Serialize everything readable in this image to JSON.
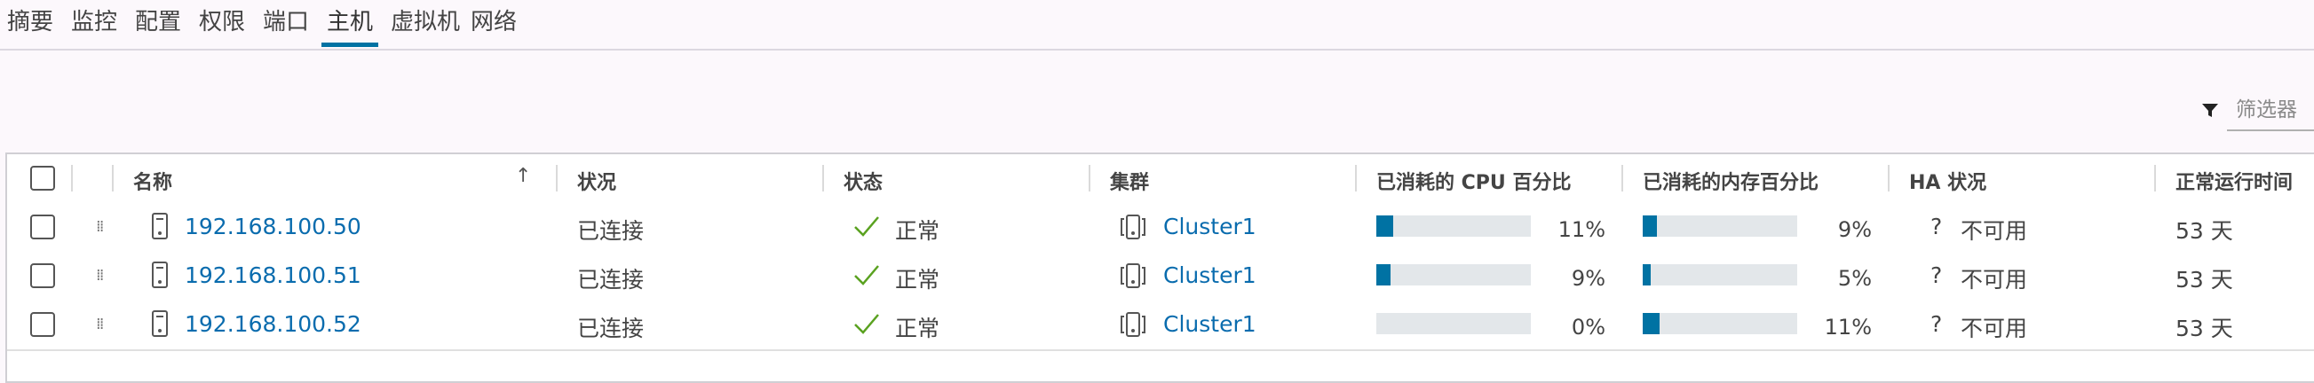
{
  "tabs": [
    "摘要",
    "监控",
    "配置",
    "权限",
    "端口",
    "主机",
    "虚拟机",
    "网络"
  ],
  "active_tab": "主机",
  "filter": {
    "placeholder": "筛选器"
  },
  "columns": {
    "name": "名称",
    "condition": "状况",
    "state": "状态",
    "cluster": "集群",
    "cpu": "已消耗的 CPU 百分比",
    "memory": "已消耗的内存百分比",
    "ha": "HA 状况",
    "uptime": "正常运行时间"
  },
  "rows": [
    {
      "name": "192.168.100.50",
      "condition": "已连接",
      "state": "正常",
      "cluster": "Cluster1",
      "cpu": "11%",
      "cpu_value": 0.11,
      "memory": "9%",
      "memory_value": 0.09,
      "ha_icon": "?",
      "ha": "不可用",
      "uptime": "53 天"
    },
    {
      "name": "192.168.100.51",
      "condition": "已连接",
      "state": "正常",
      "cluster": "Cluster1",
      "cpu": "9%",
      "cpu_value": 0.09,
      "memory": "5%",
      "memory_value": 0.05,
      "ha_icon": "?",
      "ha": "不可用",
      "uptime": "53 天"
    },
    {
      "name": "192.168.100.52",
      "condition": "已连接",
      "state": "正常",
      "cluster": "Cluster1",
      "cpu": "0%",
      "cpu_value": 0.0,
      "memory": "11%",
      "memory_value": 0.11,
      "ha_icon": "?",
      "ha": "不可用",
      "uptime": "53 天"
    }
  ],
  "colors": {
    "accent": "#0072a3",
    "link": "#0a6cae",
    "ok": "#5aa220",
    "bar_track": "#e3e7ea"
  },
  "icons": {
    "sort": "arrow-up-icon",
    "filter": "funnel-icon",
    "host": "server-icon",
    "state": "checkmark-icon",
    "cluster": "cluster-icon",
    "drag": "drag-handle-icon"
  }
}
